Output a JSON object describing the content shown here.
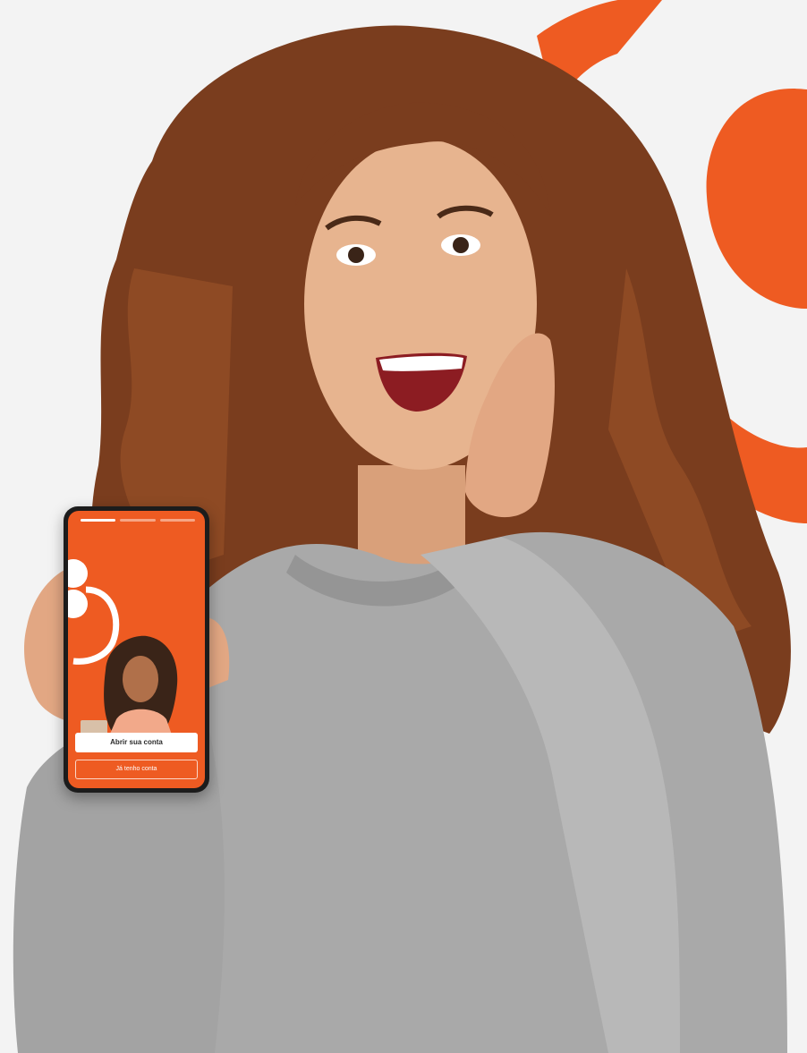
{
  "colors": {
    "brand_orange": "#ee5b22",
    "background": "#f3f3f3",
    "sweater_gray": "#a9a9a9",
    "hair_brown": "#7a3d1e",
    "skin": "#e7b48f",
    "button_white": "#ffffff"
  },
  "phone": {
    "progress_segments": 3,
    "active_segment": 1,
    "logo_icon": "brand-logo-icon",
    "buttons": {
      "primary_label": "Abrir sua conta",
      "secondary_label": "Já tenho conta"
    }
  }
}
